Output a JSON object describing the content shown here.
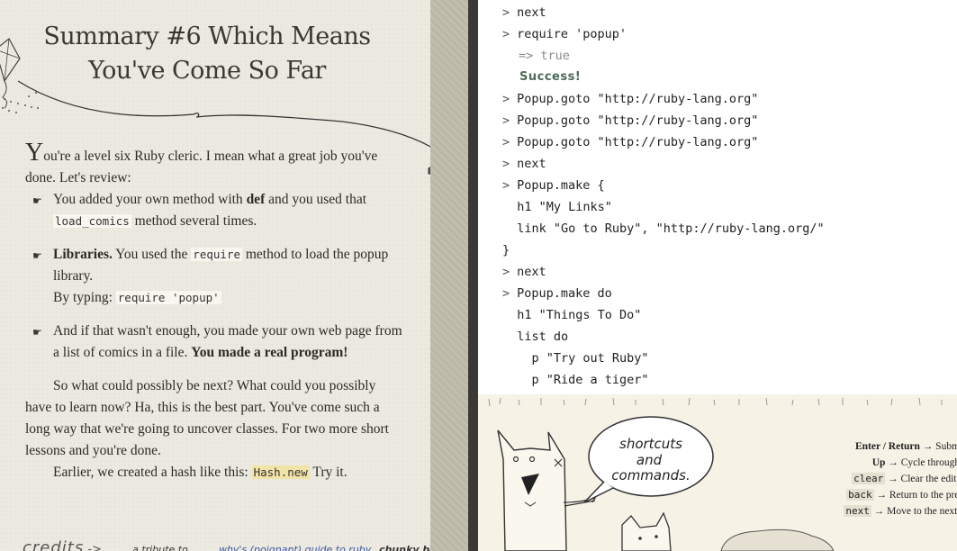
{
  "lesson": {
    "title_line1": "Summary #6 Which Means",
    "title_line2": "You've Come So Far",
    "intro_dropcap": "Y",
    "intro_rest": "ou're a level six Ruby cleric. I mean what a great job you've done. Let's review:",
    "items": [
      {
        "pre": "You added your own method with ",
        "bold": "def",
        "mid": " and you used that ",
        "code": "load_comics",
        "post": " method several times."
      },
      {
        "bold": "Libraries.",
        "pre": " You used the ",
        "code": "require",
        "post": " method to load the popup library.",
        "line2_pre": "By typing: ",
        "line2_code": "require 'popup'"
      },
      {
        "pre": "And if that wasn't enough, you made your own web page from a list of comics in a file. ",
        "bold": "You made a real program!"
      }
    ],
    "para1": "So what could possibly be next? What could you possibly have to learn now? Ha, this is the best part. You've come such a long way that we're going to uncover classes. For two more short lessons and you're done.",
    "para2_pre": "Earlier, we created a hash like this: ",
    "para2_code": "Hash.new",
    "para2_post": " Try it."
  },
  "credits": {
    "label": "credits",
    "arrow": "->",
    "tribute": "a tribute to",
    "link": "why's (poignant) guide to ruby,",
    "bacon": "chunky bacon"
  },
  "console": {
    "prompt": ">",
    "lines": [
      {
        "type": "input",
        "text": "next"
      },
      {
        "type": "input",
        "text": "require 'popup'"
      },
      {
        "type": "return",
        "text": "=> true"
      },
      {
        "type": "success",
        "text": "Success!"
      },
      {
        "type": "input",
        "text": "Popup.goto \"http://ruby-lang.org\""
      },
      {
        "type": "input",
        "text": "Popup.goto \"http://ruby-lang.org\""
      },
      {
        "type": "input",
        "text": "Popup.goto \"http://ruby-lang.org\""
      },
      {
        "type": "input",
        "text": "next"
      },
      {
        "type": "input",
        "text": "Popup.make {"
      },
      {
        "type": "cont",
        "text": "  h1 \"My Links\""
      },
      {
        "type": "cont",
        "text": "  link \"Go to Ruby\", \"http://ruby-lang.org/\""
      },
      {
        "type": "cont",
        "text": "}"
      },
      {
        "type": "input",
        "text": "next"
      },
      {
        "type": "input",
        "text": "Popup.make do"
      },
      {
        "type": "cont",
        "text": "  h1 \"Things To Do\""
      },
      {
        "type": "cont",
        "text": "  list do"
      },
      {
        "type": "cont",
        "text": "    p \"Try out Ruby\""
      },
      {
        "type": "cont",
        "text": "    p \"Ride a tiger\""
      }
    ]
  },
  "help": {
    "bubble_line1": "shortcuts",
    "bubble_line2": "and",
    "bubble_line3": "commands.",
    "shortcuts": [
      {
        "key": "Enter / Return",
        "arrow": " → ",
        "desc": "Submit code"
      },
      {
        "key": "Up",
        "arrow": " → ",
        "desc": "Cycle through submitted code"
      },
      {
        "code": "clear",
        "arrow": " → ",
        "desc": "Clear the editor window"
      },
      {
        "code": "back",
        "arrow": " → ",
        "desc": "Return to the previous lesson"
      },
      {
        "code": "next",
        "arrow": " → ",
        "desc": "Move to the next lesson"
      }
    ]
  }
}
